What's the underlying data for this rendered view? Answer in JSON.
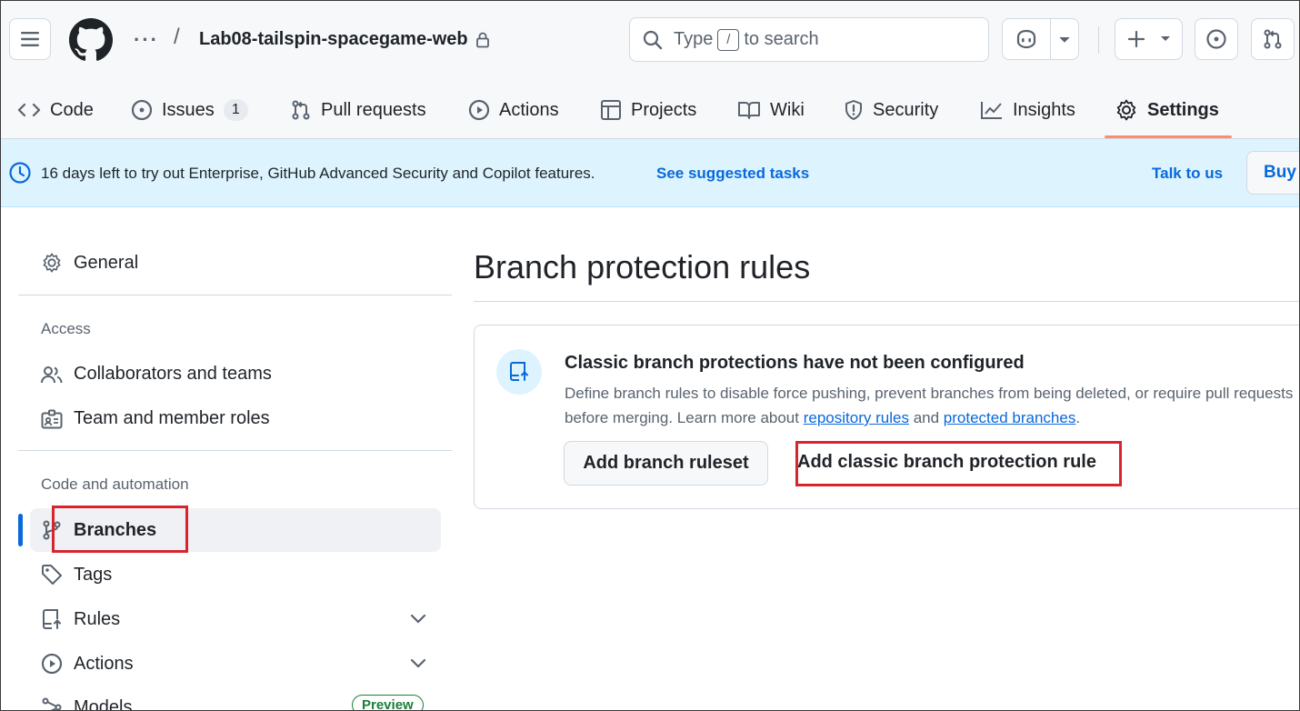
{
  "header": {
    "repo_name": "Lab08-tailspin-spacegame-web",
    "ellipsis": "···",
    "path_separator": "/",
    "search": {
      "prefix": "Type",
      "key": "/",
      "suffix": "to search"
    }
  },
  "tabs": [
    {
      "label": "Code",
      "icon": "code-icon"
    },
    {
      "label": "Issues",
      "icon": "issue-opened-icon",
      "count": "1"
    },
    {
      "label": "Pull requests",
      "icon": "git-pull-request-icon"
    },
    {
      "label": "Actions",
      "icon": "play-icon"
    },
    {
      "label": "Projects",
      "icon": "table-icon"
    },
    {
      "label": "Wiki",
      "icon": "book-icon"
    },
    {
      "label": "Security",
      "icon": "shield-icon"
    },
    {
      "label": "Insights",
      "icon": "graph-icon"
    },
    {
      "label": "Settings",
      "icon": "gear-icon",
      "active": true
    }
  ],
  "banner": {
    "text": "16 days left to try out Enterprise, GitHub Advanced Security and Copilot features.",
    "link": "See suggested tasks",
    "talk": "Talk to us",
    "buy": "Buy"
  },
  "sidebar": {
    "general": "General",
    "access_heading": "Access",
    "collaborators": "Collaborators and teams",
    "roles": "Team and member roles",
    "code_heading": "Code and automation",
    "branches": "Branches",
    "tags": "Tags",
    "rules": "Rules",
    "actions": "Actions",
    "models": "Models",
    "preview": "Preview"
  },
  "main": {
    "title": "Branch protection rules",
    "card_title": "Classic branch protections have not been configured",
    "desc_part1": "Define branch rules to disable force pushing, prevent branches from being deleted, or require pull requests before merging. Learn more about",
    "desc_link1": "repository rules",
    "desc_and": "and",
    "desc_link2": "protected branches",
    "desc_end": ".",
    "btn_ruleset": "Add branch ruleset",
    "btn_classic": "Add classic branch protection rule"
  },
  "colors": {
    "accent": "#0969da",
    "highlight": "#d7252f",
    "tab_underline": "#fd8c73",
    "banner_bg": "#ddf4ff"
  }
}
